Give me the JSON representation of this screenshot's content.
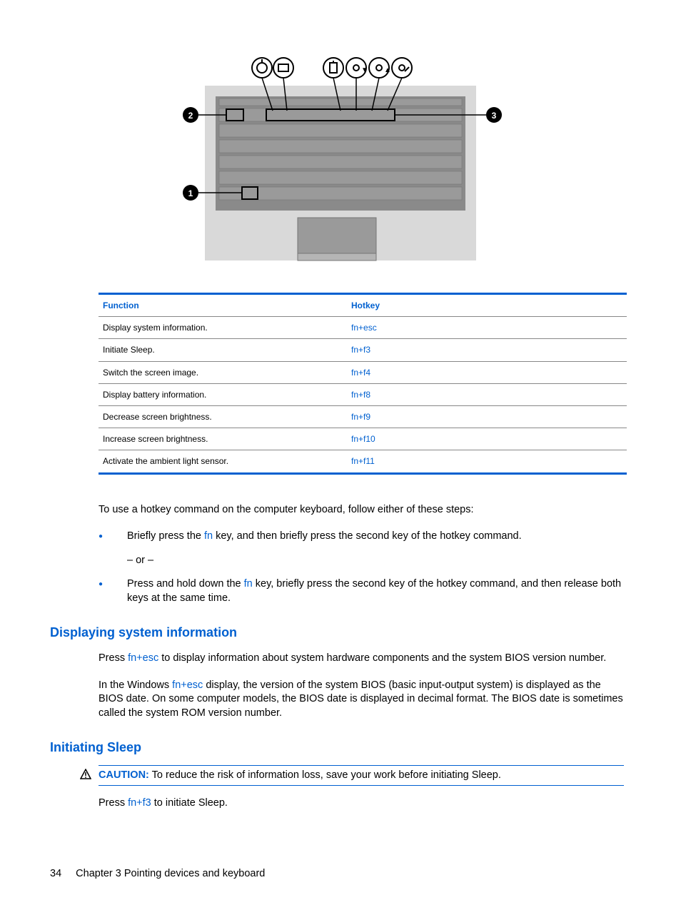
{
  "table": {
    "headers": {
      "func": "Function",
      "hotkey": "Hotkey"
    },
    "rows": [
      {
        "func": "Display system information.",
        "hotkey": "fn+esc"
      },
      {
        "func": "Initiate Sleep.",
        "hotkey": "fn+f3"
      },
      {
        "func": "Switch the screen image.",
        "hotkey": "fn+f4"
      },
      {
        "func": "Display battery information.",
        "hotkey": "fn+f8"
      },
      {
        "func": "Decrease screen brightness.",
        "hotkey": "fn+f9"
      },
      {
        "func": "Increase screen brightness.",
        "hotkey": "fn+f10"
      },
      {
        "func": "Activate the ambient light sensor.",
        "hotkey": "fn+f11"
      }
    ]
  },
  "intro": "To use a hotkey command on the computer keyboard, follow either of these steps:",
  "bullets": {
    "b1_pre": "Briefly press the ",
    "b1_key": "fn",
    "b1_post": " key, and then briefly press the second key of the hotkey command.",
    "or": "– or –",
    "b2_pre": "Press and hold down the ",
    "b2_key": "fn",
    "b2_post": " key, briefly press the second key of the hotkey command, and then release both keys at the same time."
  },
  "section1": {
    "title": "Displaying system information",
    "p1_pre": "Press ",
    "p1_key": "fn+esc",
    "p1_post": " to display information about system hardware components and the system BIOS version number.",
    "p2_pre": "In the Windows ",
    "p2_key": "fn+esc",
    "p2_post": " display, the version of the system BIOS (basic input-output system) is displayed as the BIOS date. On some computer models, the BIOS date is displayed in decimal format. The BIOS date is sometimes called the system ROM version number."
  },
  "section2": {
    "title": "Initiating Sleep",
    "caution_label": "CAUTION:",
    "caution_text": "To reduce the risk of information loss, save your work before initiating Sleep.",
    "p1_pre": "Press ",
    "p1_key": "fn+f3",
    "p1_post": " to initiate Sleep."
  },
  "footer": {
    "page": "34",
    "chapter": "Chapter 3   Pointing devices and keyboard"
  }
}
